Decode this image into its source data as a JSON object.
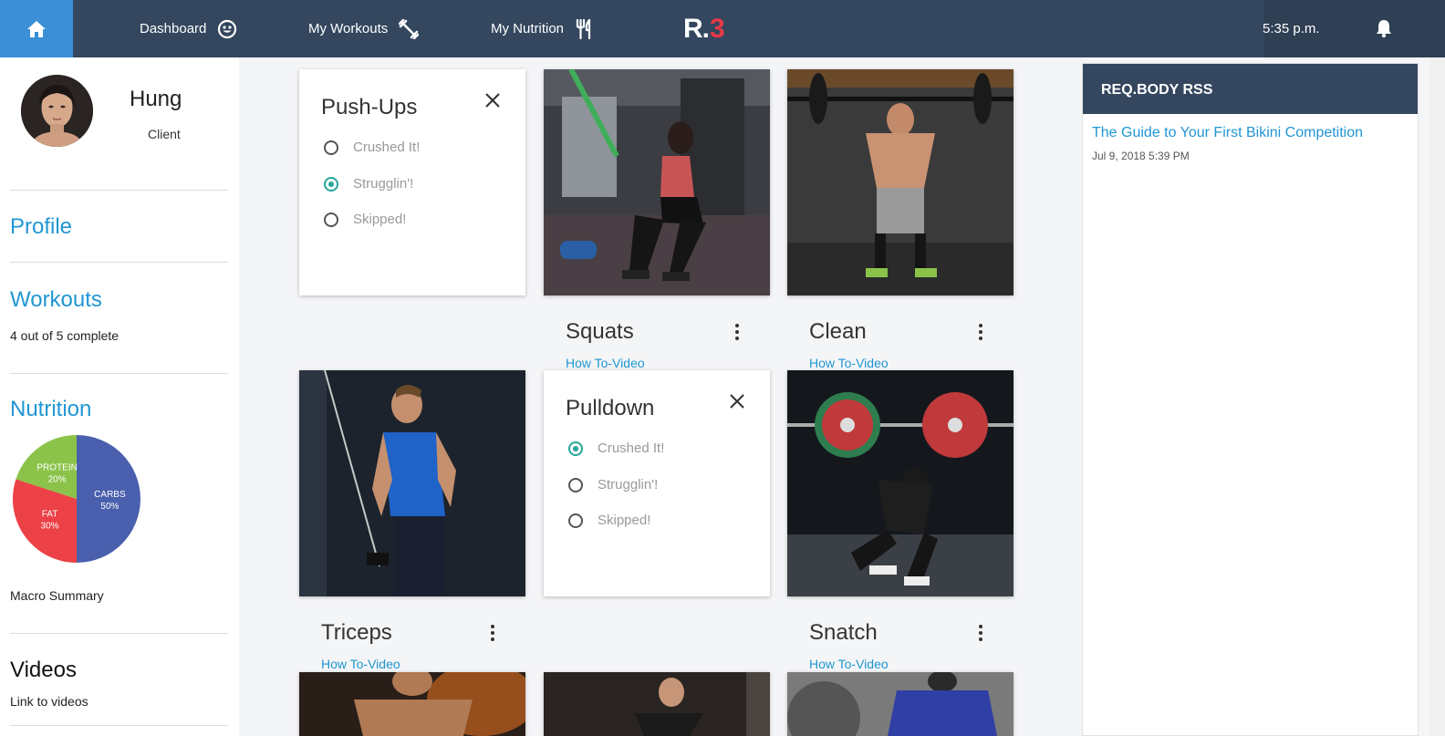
{
  "nav": {
    "items": [
      {
        "label": "Dashboard",
        "icon": "smiley-icon"
      },
      {
        "label": "My Workouts",
        "icon": "dumbbell-icon"
      },
      {
        "label": "My Nutrition",
        "icon": "utensils-icon"
      }
    ],
    "logo_main": "R.",
    "logo_accent": "3",
    "time": "5:35 p.m.",
    "colors": {
      "bar": "#34475f",
      "home": "#3a8fd6",
      "accent": "#2196d3",
      "radio": "#26a69a"
    }
  },
  "profile": {
    "name": "Hung",
    "role": "Client"
  },
  "sidebar": {
    "profile_link": "Profile",
    "workouts_link": "Workouts",
    "workouts_progress": "4 out of 5 complete",
    "nutrition_link": "Nutrition",
    "macro_label": "Macro Summary",
    "videos_heading": "Videos",
    "videos_sub": "Link to videos"
  },
  "chart_data": {
    "type": "pie",
    "categories": [
      "CARBS",
      "FAT",
      "PROTEIN"
    ],
    "values": [
      50,
      30,
      20
    ],
    "labels": [
      "50%",
      "30%",
      "20%"
    ],
    "colors": [
      "#4a5fad",
      "#ec4146",
      "#8bc34a"
    ]
  },
  "workouts": {
    "pushups": {
      "title": "Push-Ups",
      "options": [
        "Crushed It!",
        "Strugglin'!",
        "Skipped!"
      ],
      "selected": 1
    },
    "pulldown": {
      "title": "Pulldown",
      "options": [
        "Crushed It!",
        "Strugglin'!",
        "Skipped!"
      ],
      "selected": 0
    },
    "squats": {
      "title": "Squats",
      "link": "How To-Video"
    },
    "clean": {
      "title": "Clean",
      "link": "How To-Video"
    },
    "triceps": {
      "title": "Triceps",
      "link": "How To-Video"
    },
    "snatch": {
      "title": "Snatch",
      "link": "How To-Video"
    }
  },
  "rss": {
    "heading": "REQ.BODY RSS",
    "items": [
      {
        "title": "The Guide to Your First Bikini Competition",
        "date": "Jul 9, 2018 5:39 PM"
      }
    ]
  }
}
